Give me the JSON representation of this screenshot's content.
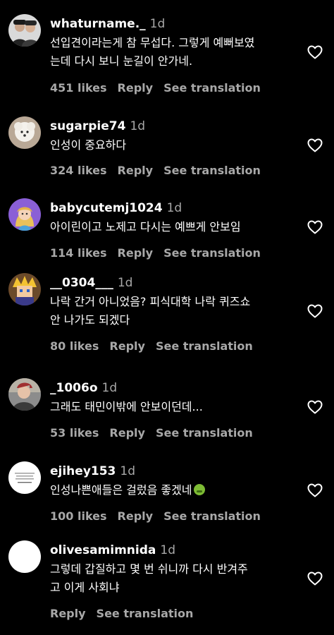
{
  "comments": [
    {
      "username": "whaturname._",
      "time": "1d",
      "lines": [
        "선입견이라는게 참 무섭다. 그렇게 예뻐보였",
        "는데 다시 보니 눈길이 안가네."
      ],
      "likes": "451 likes",
      "reply": "Reply",
      "translate": "See translation",
      "avatar_icon": "two-people-photo-avatar"
    },
    {
      "username": "sugarpie74",
      "time": "1d",
      "lines": [
        "인성이 중요하다"
      ],
      "likes": "324 likes",
      "reply": "Reply",
      "translate": "See translation",
      "avatar_icon": "white-dog-photo-avatar"
    },
    {
      "username": "babycutemj1024",
      "time": "1d",
      "lines": [
        "아이린이고 노제고 다시는 예쁘게 안보임"
      ],
      "likes": "114 likes",
      "reply": "Reply",
      "translate": "See translation",
      "avatar_icon": "cartoon-girl-avatar"
    },
    {
      "username": "__0304___",
      "time": "1d",
      "lines": [
        "나락 간거 아니었음? 피식대학 나락 퀴즈쇼",
        "안 나가도 되겠다"
      ],
      "likes": "80 likes",
      "reply": "Reply",
      "translate": "See translation",
      "avatar_icon": "pixel-character-avatar"
    },
    {
      "username": "_1006o",
      "time": "1d",
      "lines": [
        "그래도 태민이밖에 안보이던데..."
      ],
      "likes": "53 likes",
      "reply": "Reply",
      "translate": "See translation",
      "avatar_icon": "photo-avatar"
    },
    {
      "username": "ejihey153",
      "time": "1d",
      "lines": [
        "인성나쁜애들은 걸렀음 좋겠네"
      ],
      "likes": "100 likes",
      "reply": "Reply",
      "translate": "See translation",
      "avatar_icon": "text-logo-avatar",
      "emoji": "nauseated-face-emoji"
    },
    {
      "username": "olivesamimnida",
      "time": "1d",
      "lines": [
        "그렇데 갑질하고 몇 번 쉬니까 다시 반겨주",
        "고 이게 사회냐"
      ],
      "likes": "",
      "reply": "Reply",
      "translate": "See translation",
      "avatar_icon": "blank-white-avatar"
    }
  ],
  "like_icon": "heart-outline-icon",
  "colors": {
    "background": "#000000",
    "primary_text": "#ffffff",
    "secondary_text": "#a8a8a8"
  }
}
